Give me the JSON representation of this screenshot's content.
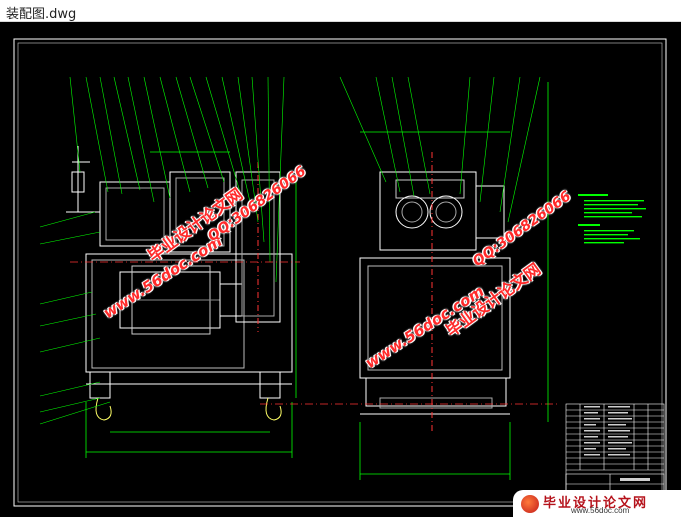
{
  "window": {
    "title": "装配图.dwg"
  },
  "watermarks": {
    "site": "www.56doc.com",
    "qq": "QQ:306826066",
    "cn": "毕业设计论文网"
  },
  "brand": {
    "name": "毕业设计论文网",
    "url": "www.56doc.com"
  },
  "colors": {
    "background": "#000000",
    "frame": "#ffffff",
    "geometry": "#ffffff",
    "leaders": "#00ff00",
    "centerlines": "#ff3333",
    "dimension": "#00ff00",
    "watermark": "#ff2a2a"
  }
}
